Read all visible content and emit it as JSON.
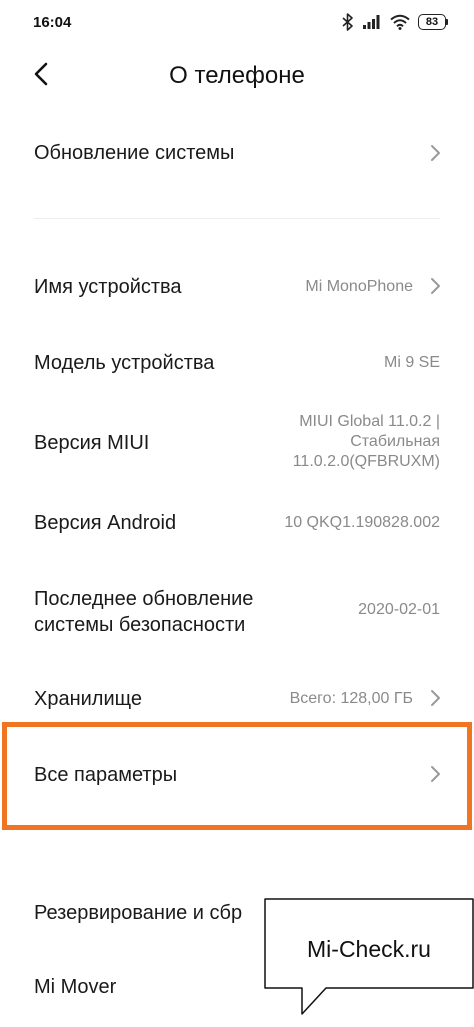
{
  "status_bar": {
    "time": "16:04",
    "battery": "83",
    "icons": [
      "bluetooth-icon",
      "signal-icon",
      "wifi-icon",
      "battery-icon"
    ]
  },
  "header": {
    "title": "О телефоне",
    "back_icon": "chevron-left-icon"
  },
  "rows": [
    {
      "label": "Обновление системы",
      "value": ""
    },
    {
      "label": "Имя устройства",
      "value": "Mi MonoPhone"
    },
    {
      "label": "Модель устройства",
      "value": "Mi 9 SE"
    },
    {
      "label": "Версия MIUI",
      "value_lines": [
        "MIUI Global 11.0.2 |",
        "Стабильная",
        "11.0.2.0(QFBRUXM)"
      ]
    },
    {
      "label": "Версия Android",
      "value": "10 QKQ1.190828.002"
    },
    {
      "label_lines": [
        "Последнее обновление",
        "системы безопасности"
      ],
      "value": "2020-02-01"
    },
    {
      "label": "Хранилище",
      "value": "Всего: 128,00 ГБ"
    },
    {
      "label": "Все параметры",
      "value": ""
    },
    {
      "label": "Резервирование и сбр",
      "value": ""
    },
    {
      "label": "Mi Mover",
      "value": ""
    }
  ],
  "highlight_color": "#f07522",
  "watermark": {
    "text": "Mi-Check.ru"
  }
}
